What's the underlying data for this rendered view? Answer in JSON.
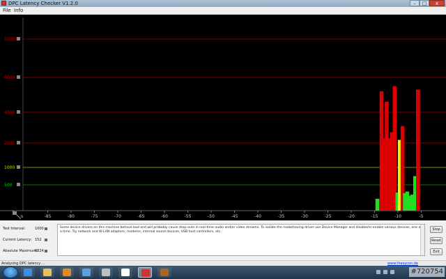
{
  "window": {
    "title": "DPC Latency Checker V1.2.0",
    "min_label": "–",
    "max_label": "□",
    "close_label": "x"
  },
  "menu": {
    "file": "File",
    "info": "Info"
  },
  "chart_data": {
    "type": "bar",
    "ylabel_unit": "µs",
    "yticks": [
      {
        "value": 10000,
        "label": "10000",
        "color": "#cc0000"
      },
      {
        "value": 6000,
        "label": "6000",
        "color": "#cc0000"
      },
      {
        "value": 4000,
        "label": "4000",
        "color": "#cc0000"
      },
      {
        "value": 2000,
        "label": "2000",
        "color": "#cc0000"
      },
      {
        "value": 1000,
        "label": "1000",
        "color": "#dddd00"
      },
      {
        "value": 500,
        "label": "500",
        "color": "#00cc00"
      }
    ],
    "xticks": [
      -85,
      -80,
      -75,
      -70,
      -65,
      -60,
      -55,
      -50,
      -45,
      -40,
      -35,
      -30,
      -25,
      -20,
      -15,
      -10,
      -5
    ],
    "corner_label": "s",
    "xlim": [
      -90,
      -0.3
    ],
    "bars": [
      {
        "x": -14.4,
        "value": 230,
        "color": "#22dd22"
      },
      {
        "x": -13.5,
        "value": 5200,
        "color": "#dd0000"
      },
      {
        "x": -12.9,
        "value": 2300,
        "color": "#dd0000"
      },
      {
        "x": -12.4,
        "value": 4600,
        "color": "#dd0000"
      },
      {
        "x": -11.8,
        "value": 2300,
        "color": "#dd0000"
      },
      {
        "x": -11.3,
        "value": 2700,
        "color": "#dd0000"
      },
      {
        "x": -10.7,
        "value": 5500,
        "color": "#dd0000"
      },
      {
        "x": -10.1,
        "value": 350,
        "color": "#22dd22"
      },
      {
        "x": -9.6,
        "value": 2200,
        "color": "#ffee00"
      },
      {
        "x": -9.0,
        "value": 3100,
        "color": "#dd0000"
      },
      {
        "x": -8.5,
        "value": 340,
        "color": "#22dd22"
      },
      {
        "x": -8.0,
        "value": 370,
        "color": "#22dd22"
      },
      {
        "x": -7.4,
        "value": 290,
        "color": "#22dd22"
      },
      {
        "x": -6.9,
        "value": 310,
        "color": "#22dd22"
      },
      {
        "x": -6.3,
        "value": 750,
        "color": "#22dd22"
      },
      {
        "x": -5.7,
        "value": 5300,
        "color": "#dd0000"
      }
    ]
  },
  "stats": {
    "test_interval_label": "Test Interval:",
    "test_interval_value": "1000",
    "current_latency_label": "Current Latency:",
    "current_latency_value": "152",
    "absolute_max_label": "Absolute Maximum:",
    "absolute_max_value": "6824"
  },
  "message": "Some device drivers on this machine behave bad and will probably cause drop-outs in real-time audio and/or video streams. To isolate the misbehaving driver use Device Manager and disable/re-enable various devices, one at a time. Try network and W-LAN adapters, modems, internal sound devices, USB host controllers, etc.",
  "buttons": {
    "stop": "Stop",
    "reset": "Reset",
    "exit": "Exit"
  },
  "status": {
    "text": "Analysing DPC latency ...",
    "link": "www.thesycon.de"
  },
  "watermark": "#720754",
  "taskbar_icons": [
    {
      "name": "ie-icon",
      "color": "#3a8ee6",
      "active": false
    },
    {
      "name": "explorer-icon",
      "color": "#e8c060",
      "active": false
    },
    {
      "name": "media-player-icon",
      "color": "#e08a20",
      "active": false
    },
    {
      "name": "network-icon",
      "color": "#5aa0e0",
      "active": false
    },
    {
      "name": "winamp-icon",
      "color": "#c0c0c0",
      "active": false
    },
    {
      "name": "shield-app-icon",
      "color": "#ffffff",
      "active": false
    },
    {
      "name": "dpc-checker-icon",
      "color": "#cc3333",
      "active": true
    },
    {
      "name": "app-dark-icon",
      "color": "#aa6622",
      "active": false
    }
  ]
}
